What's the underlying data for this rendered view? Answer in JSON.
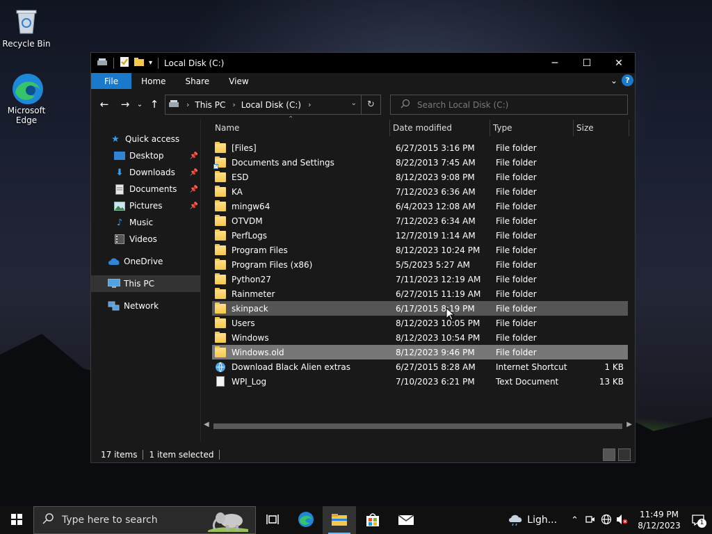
{
  "desktop": {
    "icons": [
      {
        "label": "Recycle Bin"
      },
      {
        "label": "Microsoft Edge"
      }
    ]
  },
  "window": {
    "title": "Local Disk (C:)",
    "ribbon_tabs": [
      "File",
      "Home",
      "Share",
      "View"
    ],
    "help_label": "?",
    "address": {
      "crumbs": [
        "This PC",
        "Local Disk (C:)"
      ]
    },
    "search": {
      "placeholder": "Search Local Disk (C:)"
    },
    "sidebar": [
      {
        "label": "Quick access",
        "icon": "star-icon",
        "pinned": false
      },
      {
        "label": "Desktop",
        "icon": "desktop-folder-icon",
        "pinned": true
      },
      {
        "label": "Downloads",
        "icon": "download-arrow-icon",
        "pinned": true
      },
      {
        "label": "Documents",
        "icon": "documents-icon",
        "pinned": true
      },
      {
        "label": "Pictures",
        "icon": "pictures-icon",
        "pinned": true
      },
      {
        "label": "Music",
        "icon": "music-note-icon",
        "pinned": false
      },
      {
        "label": "Videos",
        "icon": "video-icon",
        "pinned": false
      },
      {
        "label": "OneDrive",
        "icon": "cloud-icon",
        "pinned": false
      },
      {
        "label": "This PC",
        "icon": "monitor-icon",
        "pinned": false
      },
      {
        "label": "Network",
        "icon": "network-icon",
        "pinned": false
      }
    ],
    "columns": [
      "Name",
      "Date modified",
      "Type",
      "Size"
    ],
    "files": [
      {
        "name": "[Files]",
        "date": "6/27/2015 3:16 PM",
        "type": "File folder",
        "size": "",
        "kind": "folder"
      },
      {
        "name": "Documents and Settings",
        "date": "8/22/2013 7:45 AM",
        "type": "File folder",
        "size": "",
        "kind": "folder-link"
      },
      {
        "name": "ESD",
        "date": "8/12/2023 9:08 PM",
        "type": "File folder",
        "size": "",
        "kind": "folder"
      },
      {
        "name": "KA",
        "date": "7/12/2023 6:36 AM",
        "type": "File folder",
        "size": "",
        "kind": "folder"
      },
      {
        "name": "mingw64",
        "date": "6/4/2023 12:08 AM",
        "type": "File folder",
        "size": "",
        "kind": "folder"
      },
      {
        "name": "OTVDM",
        "date": "7/12/2023 6:34 AM",
        "type": "File folder",
        "size": "",
        "kind": "folder"
      },
      {
        "name": "PerfLogs",
        "date": "12/7/2019 1:14 AM",
        "type": "File folder",
        "size": "",
        "kind": "folder"
      },
      {
        "name": "Program Files",
        "date": "8/12/2023 10:24 PM",
        "type": "File folder",
        "size": "",
        "kind": "folder"
      },
      {
        "name": "Program Files (x86)",
        "date": "5/5/2023 5:27 AM",
        "type": "File folder",
        "size": "",
        "kind": "folder"
      },
      {
        "name": "Python27",
        "date": "7/11/2023 12:19 AM",
        "type": "File folder",
        "size": "",
        "kind": "folder"
      },
      {
        "name": "Rainmeter",
        "date": "6/27/2015 11:19 AM",
        "type": "File folder",
        "size": "",
        "kind": "folder"
      },
      {
        "name": "skinpack",
        "date": "6/17/2015 8:19 PM",
        "type": "File folder",
        "size": "",
        "kind": "folder",
        "state": "hover"
      },
      {
        "name": "Users",
        "date": "8/12/2023 10:05 PM",
        "type": "File folder",
        "size": "",
        "kind": "folder"
      },
      {
        "name": "Windows",
        "date": "8/12/2023 10:54 PM",
        "type": "File folder",
        "size": "",
        "kind": "folder"
      },
      {
        "name": "Windows.old",
        "date": "8/12/2023 9:46 PM",
        "type": "File folder",
        "size": "",
        "kind": "folder",
        "state": "selected"
      },
      {
        "name": "Download Black Alien extras",
        "date": "6/27/2015 8:28 AM",
        "type": "Internet Shortcut",
        "size": "1 KB",
        "kind": "shortcut"
      },
      {
        "name": "WPI_Log",
        "date": "7/10/2023 6:21 PM",
        "type": "Text Document",
        "size": "13 KB",
        "kind": "text"
      }
    ],
    "status": {
      "items": "17 items",
      "selected": "1 item selected"
    }
  },
  "taskbar": {
    "search_placeholder": "Type here to search",
    "weather": "Ligh...",
    "time": "11:49 PM",
    "date": "8/12/2023",
    "notification_count": "1"
  },
  "colors": {
    "accent": "#1979ca",
    "selected_row": "#777777",
    "hover_row": "#555555"
  }
}
